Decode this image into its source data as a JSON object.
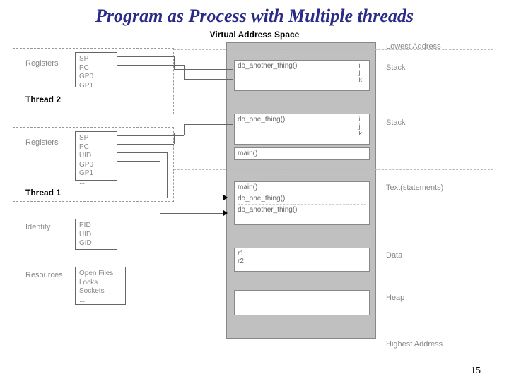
{
  "title": "Program as Process with Multiple threads",
  "subtitle": "Virtual Address Space",
  "thread2": {
    "label": "Thread 2",
    "regLabel": "Registers",
    "regs": [
      "SP",
      "PC",
      "GP0",
      "GP1"
    ]
  },
  "thread1": {
    "label": "Thread 1",
    "regLabel": "Registers",
    "regs": [
      "SP",
      "PC",
      "UID",
      "GP0",
      "GP1",
      "..."
    ]
  },
  "identity": {
    "label": "Identity",
    "items": [
      "PID",
      "UID",
      "GID"
    ]
  },
  "resources": {
    "label": "Resources",
    "items": [
      "Open Files",
      "Locks",
      "Sockets",
      "..."
    ]
  },
  "vas": {
    "lowest": "Lowest Address",
    "highest": "Highest Address",
    "stack2": {
      "fn": "do_another_thing()",
      "vars": [
        "i",
        "j",
        "k"
      ],
      "label": "Stack"
    },
    "stack1": {
      "fn": "do_one_thing()",
      "vars": [
        "i",
        "j",
        "k"
      ],
      "main": "main()",
      "label": "Stack"
    },
    "text": {
      "lines": [
        "main()",
        "do_one_thing()",
        "do_another_thing()"
      ],
      "label": "Text(statements)"
    },
    "data": {
      "vars": [
        "r1",
        "r2"
      ],
      "label": "Data"
    },
    "heap": {
      "label": "Heap"
    }
  },
  "page": "15"
}
